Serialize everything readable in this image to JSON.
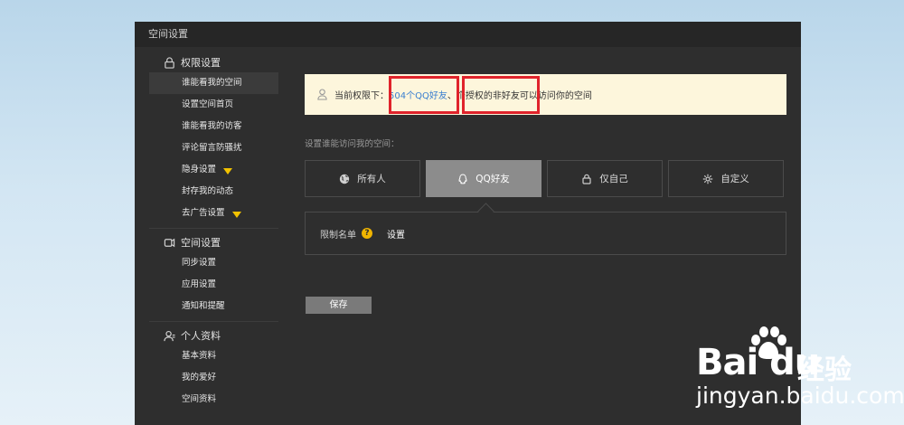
{
  "window": {
    "title": "空间设置"
  },
  "sidebar": {
    "groups": [
      {
        "label": "权限设置",
        "icon": "lock-icon",
        "items": [
          {
            "label": "谁能看我的空间",
            "active": true
          },
          {
            "label": "设置空间首页"
          },
          {
            "label": "谁能看我的访客"
          },
          {
            "label": "评论留言防骚扰"
          },
          {
            "label": "隐身设置",
            "badge": "diamond-icon"
          },
          {
            "label": "封存我的动态"
          },
          {
            "label": "去广告设置",
            "badge": "diamond-icon"
          }
        ]
      },
      {
        "label": "空间设置",
        "icon": "space-icon",
        "items": [
          {
            "label": "同步设置"
          },
          {
            "label": "应用设置"
          },
          {
            "label": "通知和提醒"
          }
        ]
      },
      {
        "label": "个人资料",
        "icon": "profile-icon",
        "items": [
          {
            "label": "基本资料"
          },
          {
            "label": "我的爱好"
          },
          {
            "label": "空间资料"
          }
        ]
      }
    ]
  },
  "notice": {
    "prefix": "当前权限下：",
    "qq_friends": "504个QQ好友",
    "middle": "、",
    "authorized": "个授权的非好友",
    "suffix": "可以访问你的空间"
  },
  "caption": "设置谁能访问我的空间：",
  "tabs": [
    {
      "label": "所有人",
      "icon": "globe-icon"
    },
    {
      "label": "QQ好友",
      "icon": "qq-icon",
      "active": true
    },
    {
      "label": "仅自己",
      "icon": "lock-icon"
    },
    {
      "label": "自定义",
      "icon": "gear-icon"
    }
  ],
  "restrict": {
    "label": "限制名单",
    "help": "?",
    "link": "设置"
  },
  "save_label": "保存",
  "watermark": {
    "logo": "Bai du",
    "cn": "经验",
    "url": "jingyan.baidu.com"
  },
  "colors": {
    "highlight_box": "#e0232b",
    "diamond": "#f2c200",
    "notice_bg": "#fdf6dc"
  }
}
